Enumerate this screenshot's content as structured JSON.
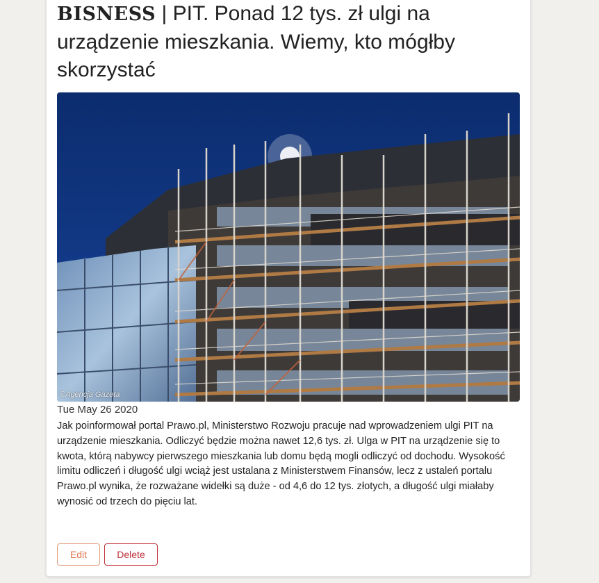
{
  "article": {
    "brand": "BISNESS",
    "separator": "|",
    "headline": "PIT. Ponad 12 tys. zł ulgi na urządzenie mieszkania. Wiemy, kto mógłby skorzystać",
    "image": {
      "credit": "©Agencja Gazeta"
    },
    "date": "Tue May 26 2020",
    "body": "Jak poinformował portal Prawo.pl, Ministerstwo Rozwoju pracuje nad wprowadzeniem ulgi PIT na urządzenie mieszkania. Odliczyć będzie można nawet 12,6 tys. zł. Ulga w PIT na urządzenie się to kwota, którą nabywcy pierwszego mieszkania lub domu będą mogli odliczyć od dochodu. Wysokość limitu odliczeń i długość ulgi wciąż jest ustalana z Ministerstwem Finansów, lecz z ustaleń portalu Prawo.pl wynika, że rozważane widełki są duże - od 4,6 do 12 tys. złotych, a długość ulgi miałaby wynosić od trzech do pięciu lat."
  },
  "actions": {
    "edit_label": "Edit",
    "delete_label": "Delete"
  },
  "colors": {
    "edit_accent": "#e07a52",
    "delete_accent": "#c0323a",
    "page_background": "#f2f0ec"
  }
}
